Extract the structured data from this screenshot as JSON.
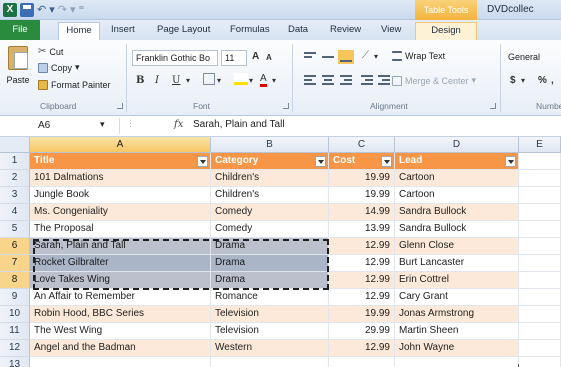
{
  "window": {
    "app_icon": "X",
    "title": "DVDcollec",
    "context_tab": "Table Tools"
  },
  "tabs": [
    "File",
    "Home",
    "Insert",
    "Page Layout",
    "Formulas",
    "Data",
    "Review",
    "View",
    "Design"
  ],
  "ribbon": {
    "clipboard": {
      "paste": "Paste",
      "cut": "Cut",
      "copy": "Copy",
      "format_painter": "Format Painter",
      "label": "Clipboard"
    },
    "font": {
      "font_name": "Franklin Gothic Bo",
      "font_size": "11",
      "bold": "B",
      "italic": "I",
      "underline": "U",
      "grow": "A",
      "shrink": "A",
      "font_color": "A",
      "label": "Font"
    },
    "alignment": {
      "wrap_text": "Wrap Text",
      "merge_center": "Merge & Center",
      "label": "Alignment"
    },
    "number": {
      "format": "General",
      "currency": "$",
      "percent": "%",
      "label": "Numbe"
    }
  },
  "formula_bar": {
    "name_box": "A6",
    "fx": "fx",
    "value": "Sarah, Plain and Tall"
  },
  "columns": [
    "A",
    "B",
    "C",
    "D",
    "E"
  ],
  "row_numbers": [
    "1",
    "2",
    "3",
    "4",
    "5",
    "6",
    "7",
    "8",
    "9",
    "10",
    "11",
    "12",
    "13"
  ],
  "table": {
    "headers": [
      "Title",
      "Category",
      "Cost",
      "Lead"
    ],
    "rows": [
      [
        "101 Dalmations",
        "Children's",
        "19.99",
        "Cartoon"
      ],
      [
        "Jungle Book",
        "Children's",
        "19.99",
        "Cartoon"
      ],
      [
        "Ms. Congeniality",
        "Comedy",
        "14.99",
        "Sandra Bullock"
      ],
      [
        "The Proposal",
        "Comedy",
        "13.99",
        "Sandra Bullock"
      ],
      [
        "Sarah, Plain and Tall",
        "Drama",
        "12.99",
        "Glenn Close"
      ],
      [
        "Rocket Gilbralter",
        "Drama",
        "12.99",
        "Burt Lancaster"
      ],
      [
        "Love Takes Wing",
        "Drama",
        "12.99",
        "Erin Cottrel"
      ],
      [
        "An Affair to Remember",
        "Romance",
        "12.99",
        "Cary Grant"
      ],
      [
        "Robin Hood, BBC Series",
        "Television",
        "19.99",
        "Jonas Armstrong"
      ],
      [
        "The West Wing",
        "Television",
        "29.99",
        "Martin Sheen"
      ],
      [
        "Angel and the Badman",
        "Western",
        "12.99",
        "John Wayne"
      ]
    ]
  }
}
